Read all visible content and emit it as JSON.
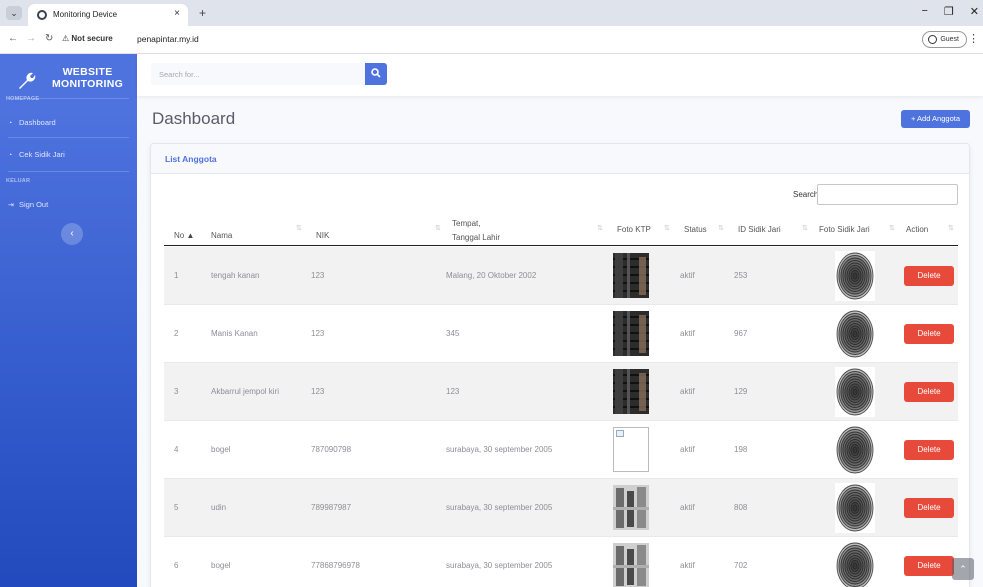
{
  "browser": {
    "tab_title": "Monitoring Device",
    "tab_close": "×",
    "new_tab": "+",
    "not_secure": "Not secure",
    "url": "penapintar.my.id",
    "profile": "Guest"
  },
  "sidebar": {
    "brand_line1": "WEBSITE",
    "brand_line2": "MONITORING",
    "heading_homepage": "HOMEPAGE",
    "item_dashboard": "Dashboard",
    "item_cek": "Cek Sidik Jari",
    "heading_keluar": "KELUAR",
    "item_signout": "Sign Out"
  },
  "topbar": {
    "search_placeholder": "Search for..."
  },
  "page": {
    "title": "Dashboard",
    "add_button": "+ Add Anggota"
  },
  "card": {
    "title": "List Anggota",
    "search_label": "Search:"
  },
  "table": {
    "headers": {
      "no": "No",
      "nama": "Nama",
      "nik": "NIK",
      "ttl_1": "Tempat,",
      "ttl_2": "Tanggal Lahir",
      "foto_ktp": "Foto KTP",
      "status": "Status",
      "id_sidik": "ID Sidik Jari",
      "foto_sidik": "Foto Sidik Jari",
      "action": "Action"
    },
    "delete_label": "Delete",
    "rows": [
      {
        "no": "1",
        "nama": "tengah kanan",
        "nik": "123",
        "ttl": "Malang, 20 Oktober 2002",
        "status": "aktif",
        "id": "253"
      },
      {
        "no": "2",
        "nama": "Manis Kanan",
        "nik": "123",
        "ttl": "345",
        "status": "aktif",
        "id": "967"
      },
      {
        "no": "3",
        "nama": "Akbarrul jempol kiri",
        "nik": "123",
        "ttl": "123",
        "status": "aktif",
        "id": "129"
      },
      {
        "no": "4",
        "nama": "bogel",
        "nik": "787090798",
        "ttl": "surabaya, 30 september 2005",
        "status": "aktif",
        "id": "198"
      },
      {
        "no": "5",
        "nama": "udin",
        "nik": "789987987",
        "ttl": "surabaya, 30 september 2005",
        "status": "aktif",
        "id": "808"
      },
      {
        "no": "6",
        "nama": "bogel",
        "nik": "77868796978",
        "ttl": "surabaya, 30 september 2005",
        "status": "aktif",
        "id": "702"
      }
    ]
  },
  "colors": {
    "primary": "#4e73df",
    "danger": "#e74a3b",
    "sidebar_end": "#224abe"
  }
}
